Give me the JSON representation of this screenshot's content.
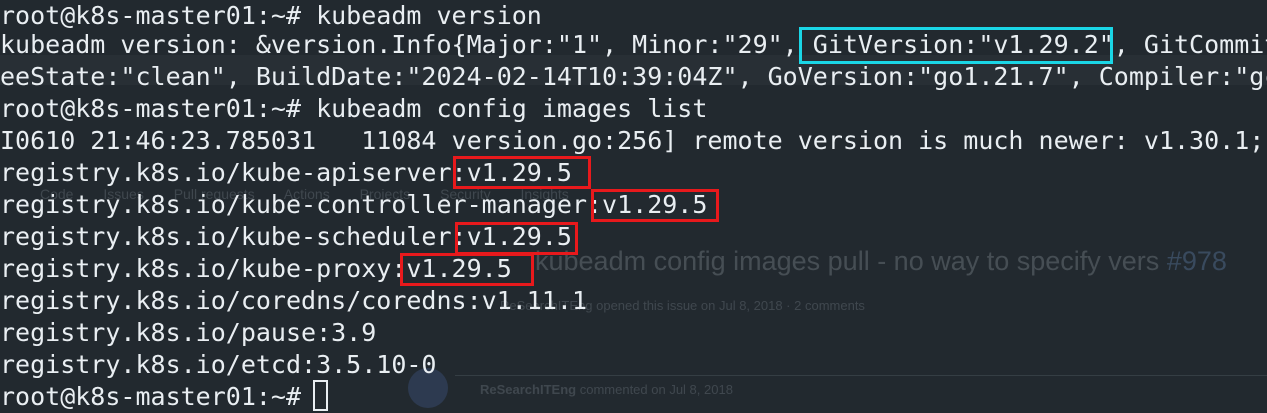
{
  "background_page": {
    "tabs": [
      "Code",
      "Issues",
      "Pull requests",
      "Actions",
      "Projects",
      "Security",
      "Insights"
    ],
    "issue_title": "kubeadm config images pull - no way to specify vers",
    "issue_number": "#978",
    "issue_meta": "ReSearchITEng opened this issue on Jul 8, 2018 · 2 comments",
    "comment_author": "ReSearchITEng",
    "comment_meta": "commented on Jul 8, 2018"
  },
  "terminal": {
    "lines": [
      "root@k8s-master01:~# kubeadm version",
      "kubeadm version: &version.Info{Major:\"1\", Minor:\"29\", GitVersion:\"v1.29.2\", GitCommit",
      "eeState:\"clean\", BuildDate:\"2024-02-14T10:39:04Z\", GoVersion:\"go1.21.7\", Compiler:\"gc",
      "root@k8s-master01:~# kubeadm config images list",
      "I0610 21:46:23.785031   11084 version.go:256] remote version is much newer: v1.30.1;",
      "registry.k8s.io/kube-apiserver:v1.29.5",
      "registry.k8s.io/kube-controller-manager:v1.29.5",
      "registry.k8s.io/kube-scheduler:v1.29.5",
      "registry.k8s.io/kube-proxy:v1.29.5",
      "registry.k8s.io/coredns/coredns:v1.11.1",
      "registry.k8s.io/pause:3.9",
      "registry.k8s.io/etcd:3.5.10-0",
      "root@k8s-master01:~# "
    ]
  },
  "colors": {
    "terminal_bg": "#22292f",
    "text": "#e9eef2",
    "highlight_cyan": "#1ad6e6",
    "highlight_red": "#e8191c"
  }
}
